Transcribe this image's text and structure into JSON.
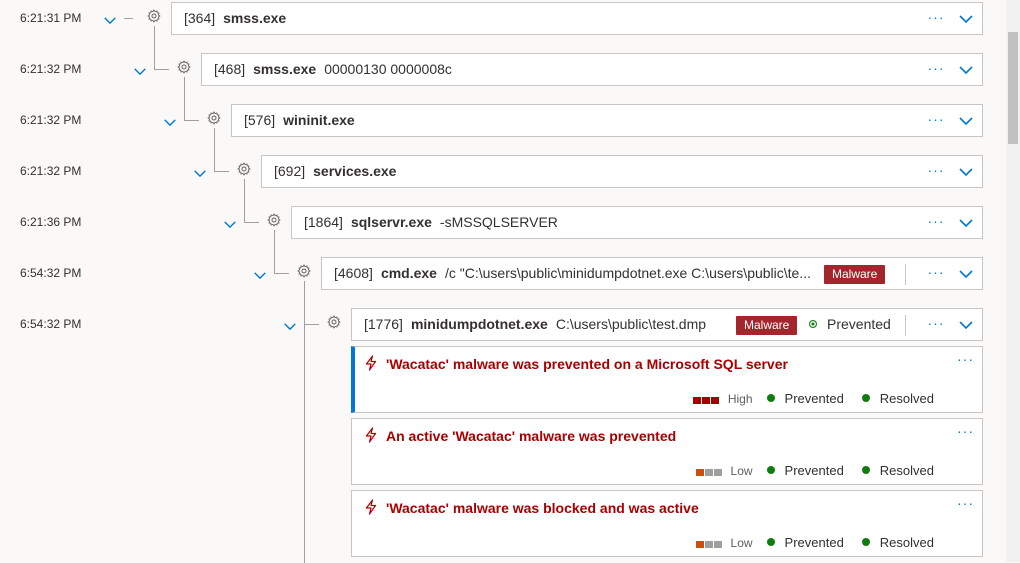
{
  "tree": {
    "nodes": [
      {
        "time": "6:21:31 PM",
        "pid": "[364]",
        "name": "smss.exe",
        "args": ""
      },
      {
        "time": "6:21:32 PM",
        "pid": "[468]",
        "name": "smss.exe",
        "args": "00000130 0000008c"
      },
      {
        "time": "6:21:32 PM",
        "pid": "[576]",
        "name": "wininit.exe",
        "args": ""
      },
      {
        "time": "6:21:32 PM",
        "pid": "[692]",
        "name": "services.exe",
        "args": ""
      },
      {
        "time": "6:21:36 PM",
        "pid": "[1864]",
        "name": "sqlservr.exe",
        "args": "-sMSSQLSERVER"
      },
      {
        "time": "6:54:32 PM",
        "pid": "[4608]",
        "name": "cmd.exe",
        "args": "/c \"C:\\users\\public\\minidumpdotnet.exe C:\\users\\public\\te...",
        "badge": "Malware"
      },
      {
        "time": "6:54:32 PM",
        "pid": "[1776]",
        "name": "minidumpdotnet.exe",
        "args": "C:\\users\\public\\test.dmp",
        "badge": "Malware",
        "status": "Prevented"
      }
    ],
    "more_label": "···",
    "expand_icon": "chevron-down-icon",
    "node_icon": "gear-icon"
  },
  "alerts": [
    {
      "title": "'Wacatac' malware was prevented on a Microsoft SQL server",
      "severity": "High",
      "severity_level": 3,
      "status": "Prevented",
      "classification": "Resolved",
      "selected": true
    },
    {
      "title": "An active 'Wacatac' malware was prevented",
      "severity": "Low",
      "severity_level": 1,
      "status": "Prevented",
      "classification": "Resolved",
      "selected": false
    },
    {
      "title": "'Wacatac' malware was blocked and was active",
      "severity": "Low",
      "severity_level": 1,
      "status": "Prevented",
      "classification": "Resolved",
      "selected": false
    }
  ],
  "colors": {
    "accent": "#0078d4",
    "malware_badge": "#a4262c",
    "alert_title": "#a80000",
    "status_green": "#107c10",
    "severity_high": "#a80000",
    "severity_low": "#ca5010",
    "severity_empty": "#a19f9d"
  }
}
